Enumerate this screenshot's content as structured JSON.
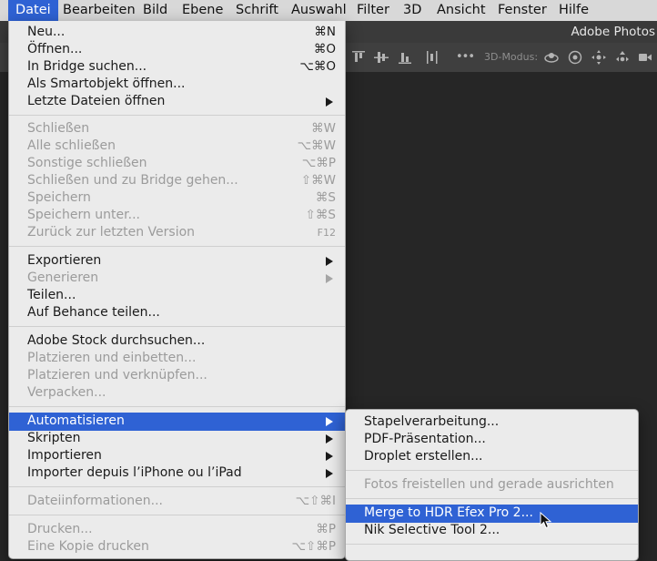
{
  "menubar": {
    "items": [
      "Datei",
      "Bearbeiten",
      "Bild",
      "Ebene",
      "Schrift",
      "Auswahl",
      "Filter",
      "3D",
      "Ansicht",
      "Fenster",
      "Hilfe"
    ],
    "active": "Datei"
  },
  "appbar": {
    "title": "Adobe Photos"
  },
  "optionsbar": {
    "mode_label": "3D-Modus:",
    "icons": [
      "align-top-icon",
      "align-vertical-center-icon",
      "align-bottom-icon",
      "distribute-icon",
      "more-icon",
      "orbit-icon",
      "roll-icon",
      "pan-icon",
      "slide-icon",
      "video-camera-icon"
    ],
    "overflow_glyph": "•••"
  },
  "file_menu": {
    "items": [
      {
        "label": "Neu...",
        "shortcut": "⌘N"
      },
      {
        "label": "Öffnen...",
        "shortcut": "⌘O"
      },
      {
        "label": "In Bridge suchen...",
        "shortcut": "⌥⌘O"
      },
      {
        "label": "Als Smartobjekt öffnen...",
        "shortcut": ""
      },
      {
        "label": "Letzte Dateien öffnen",
        "shortcut": ""
      },
      {
        "label": "Schließen",
        "shortcut": "⌘W"
      },
      {
        "label": "Alle schließen",
        "shortcut": "⌥⌘W"
      },
      {
        "label": "Sonstige schließen",
        "shortcut": "⌥⌘P"
      },
      {
        "label": "Schließen und zu Bridge gehen...",
        "shortcut": "⇧⌘W"
      },
      {
        "label": "Speichern",
        "shortcut": "⌘S"
      },
      {
        "label": "Speichern unter...",
        "shortcut": "⇧⌘S"
      },
      {
        "label": "Zurück zur letzten Version",
        "shortcut": "F12"
      },
      {
        "label": "Exportieren",
        "shortcut": ""
      },
      {
        "label": "Generieren",
        "shortcut": ""
      },
      {
        "label": "Teilen...",
        "shortcut": ""
      },
      {
        "label": "Auf Behance teilen...",
        "shortcut": ""
      },
      {
        "label": "Adobe Stock durchsuchen...",
        "shortcut": ""
      },
      {
        "label": "Platzieren und einbetten...",
        "shortcut": ""
      },
      {
        "label": "Platzieren und verknüpfen...",
        "shortcut": ""
      },
      {
        "label": "Verpacken...",
        "shortcut": ""
      },
      {
        "label": "Automatisieren",
        "shortcut": ""
      },
      {
        "label": "Skripten",
        "shortcut": ""
      },
      {
        "label": "Importieren",
        "shortcut": ""
      },
      {
        "label": "Importer depuis l’iPhone ou l’iPad",
        "shortcut": ""
      },
      {
        "label": "Dateiinformationen...",
        "shortcut": "⌥⇧⌘I"
      },
      {
        "label": "Drucken...",
        "shortcut": "⌘P"
      },
      {
        "label": "Eine Kopie drucken",
        "shortcut": "⌥⇧⌘P"
      }
    ]
  },
  "submenu": {
    "items": [
      {
        "label": "Stapelverarbeitung..."
      },
      {
        "label": "PDF-Präsentation..."
      },
      {
        "label": "Droplet erstellen..."
      },
      {
        "label": "Fotos freistellen und gerade ausrichten"
      },
      {
        "label": "Merge to HDR Efex Pro 2..."
      },
      {
        "label": "Nik Selective Tool 2..."
      }
    ]
  },
  "colors": {
    "highlight": "#2f62d4",
    "menu_bg": "#ebebeb",
    "disabled_text": "#9b9b9b",
    "canvas": "#262626"
  }
}
